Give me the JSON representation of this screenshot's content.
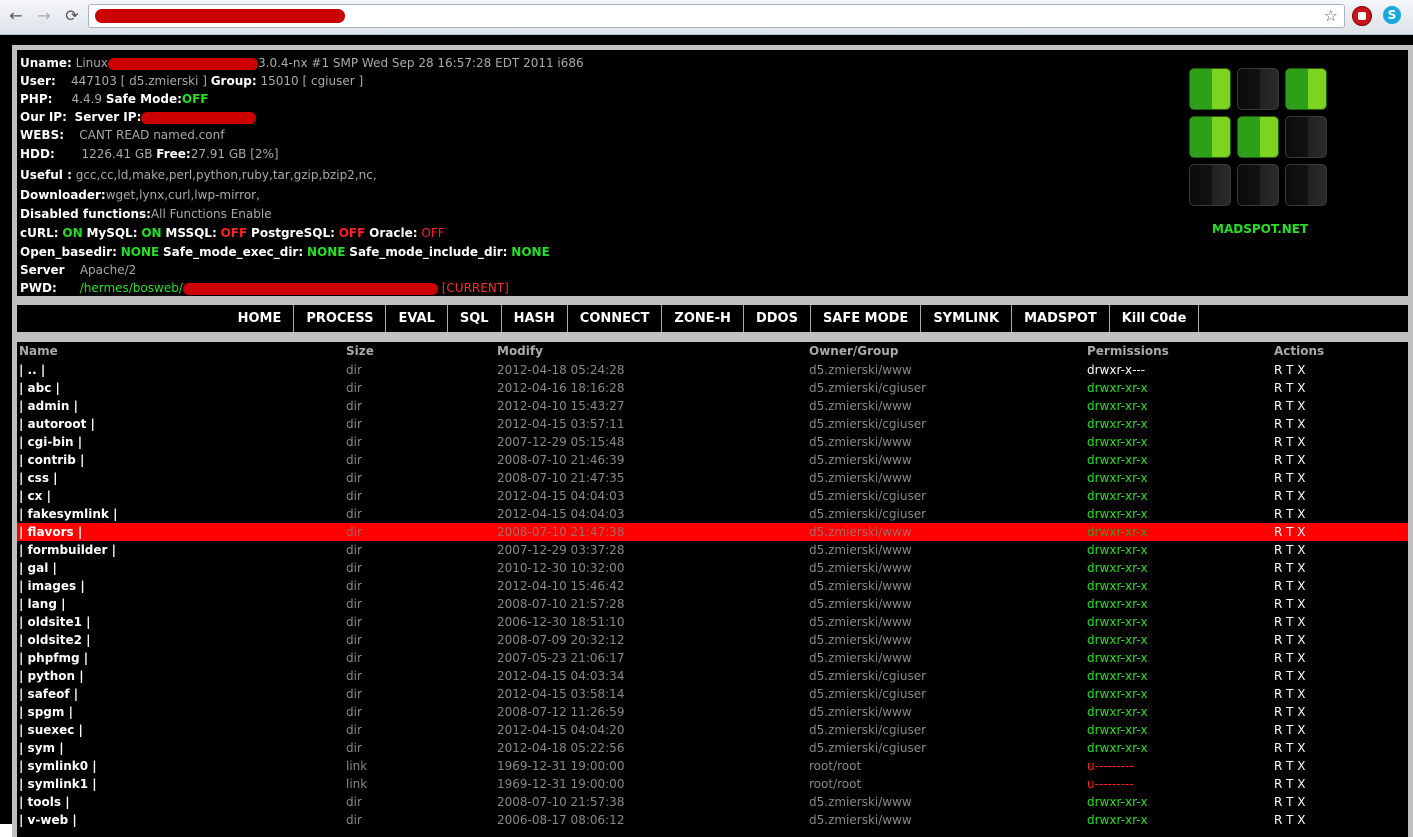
{
  "browser": {
    "back": "←",
    "forward": "→",
    "reload": "⟳",
    "star": "☆",
    "skype": "S"
  },
  "info": {
    "uname_label": "Uname:",
    "uname_prefix": "Linux",
    "uname_value": "3.0.4-nx #1 SMP Wed Sep 28 16:57:28 EDT 2011 i686",
    "user_label": "User:",
    "user_value": "447103 [ d5.zmierski ]",
    "group_label": "Group:",
    "group_value": "15010 [ cgiuser ]",
    "php_label": "PHP:",
    "php_value": "4.4.9",
    "safemode_label": "Safe Mode:",
    "safemode_value": "OFF",
    "ourip_label": "Our IP:",
    "serverip_label": "Server IP:",
    "webs_label": "WEBS:",
    "webs_value": "CANT READ named.conf",
    "hdd_label": "HDD:",
    "hdd_value": "1226.41 GB",
    "free_label": "Free:",
    "free_value": "27.91 GB [2%]",
    "useful_label": "Useful :",
    "useful_value": "gcc,cc,ld,make,perl,python,ruby,tar,gzip,bzip2,nc,",
    "downloader_label": "Downloader:",
    "downloader_value": "wget,lynx,curl,lwp-mirror,",
    "disabled_label": "Disabled functions:",
    "disabled_value": "All Functions Enable",
    "curl_label": "cURL:",
    "curl_value": "ON",
    "mysql_label": "MySQL:",
    "mysql_value": "ON",
    "mssql_label": "MSSQL:",
    "mssql_value": "OFF",
    "pgsql_label": "PostgreSQL:",
    "pgsql_value": "OFF",
    "oracle_label": "Oracle:",
    "oracle_value": "OFF",
    "openbasedir_label": "Open_basedir:",
    "openbasedir_value": "NONE",
    "exec_label": "Safe_mode_exec_dir:",
    "exec_value": "NONE",
    "include_label": "Safe_mode_include_dir:",
    "include_value": "NONE",
    "server_label": "Server",
    "server_value": "Apache/2",
    "pwd_label": "PWD:",
    "pwd_value": "/hermes/bosweb/",
    "pwd_current": "[CURRENT]"
  },
  "logo": {
    "caption": "MADSPOT.NET"
  },
  "nav": [
    "HOME",
    "PROCESS",
    "EVAL",
    "SQL",
    "HASH",
    "CONNECT",
    "ZONE-H",
    "DDOS",
    "SAFE MODE",
    "SYMLINK",
    "MADSPOT",
    "Kill C0de"
  ],
  "table": {
    "headers": {
      "name": "Name",
      "size": "Size",
      "modify": "Modify",
      "owner": "Owner/Group",
      "permissions": "Permissions",
      "actions": "Actions"
    },
    "rows": [
      {
        "name": "| .. |",
        "size": "dir",
        "modify": "2012-04-18 05:24:28",
        "owner": "d5.zmierski/www",
        "perm": "drwxr-x---",
        "actions": "R T X"
      },
      {
        "name": "| abc |",
        "size": "dir",
        "modify": "2012-04-16 18:16:28",
        "owner": "d5.zmierski/cgiuser",
        "perm": "drwxr-xr-x",
        "actions": "R T X"
      },
      {
        "name": "| admin |",
        "size": "dir",
        "modify": "2012-04-10 15:43:27",
        "owner": "d5.zmierski/www",
        "perm": "drwxr-xr-x",
        "actions": "R T X"
      },
      {
        "name": "| autoroot |",
        "size": "dir",
        "modify": "2012-04-15 03:57:11",
        "owner": "d5.zmierski/cgiuser",
        "perm": "drwxr-xr-x",
        "actions": "R T X"
      },
      {
        "name": "| cgi-bin |",
        "size": "dir",
        "modify": "2007-12-29 05:15:48",
        "owner": "d5.zmierski/www",
        "perm": "drwxr-xr-x",
        "actions": "R T X"
      },
      {
        "name": "| contrib |",
        "size": "dir",
        "modify": "2008-07-10 21:46:39",
        "owner": "d5.zmierski/www",
        "perm": "drwxr-xr-x",
        "actions": "R T X"
      },
      {
        "name": "| css |",
        "size": "dir",
        "modify": "2008-07-10 21:47:35",
        "owner": "d5.zmierski/www",
        "perm": "drwxr-xr-x",
        "actions": "R T X"
      },
      {
        "name": "| cx |",
        "size": "dir",
        "modify": "2012-04-15 04:04:03",
        "owner": "d5.zmierski/cgiuser",
        "perm": "drwxr-xr-x",
        "actions": "R T X"
      },
      {
        "name": "| fakesymlink |",
        "size": "dir",
        "modify": "2012-04-15 04:04:03",
        "owner": "d5.zmierski/cgiuser",
        "perm": "drwxr-xr-x",
        "actions": "R T X"
      },
      {
        "name": "| flavors |",
        "size": "dir",
        "modify": "2008-07-10 21:47:38",
        "owner": "d5.zmierski/www",
        "perm": "drwxr-xr-x",
        "actions": "R T X"
      },
      {
        "name": "| formbuilder |",
        "size": "dir",
        "modify": "2007-12-29 03:37:28",
        "owner": "d5.zmierski/www",
        "perm": "drwxr-xr-x",
        "actions": "R T X"
      },
      {
        "name": "| gal |",
        "size": "dir",
        "modify": "2010-12-30 10:32:00",
        "owner": "d5.zmierski/www",
        "perm": "drwxr-xr-x",
        "actions": "R T X"
      },
      {
        "name": "| images |",
        "size": "dir",
        "modify": "2012-04-10 15:46:42",
        "owner": "d5.zmierski/www",
        "perm": "drwxr-xr-x",
        "actions": "R T X"
      },
      {
        "name": "| lang |",
        "size": "dir",
        "modify": "2008-07-10 21:57:28",
        "owner": "d5.zmierski/www",
        "perm": "drwxr-xr-x",
        "actions": "R T X"
      },
      {
        "name": "| oldsite1 |",
        "size": "dir",
        "modify": "2006-12-30 18:51:10",
        "owner": "d5.zmierski/www",
        "perm": "drwxr-xr-x",
        "actions": "R T X"
      },
      {
        "name": "| oldsite2 |",
        "size": "dir",
        "modify": "2008-07-09 20:32:12",
        "owner": "d5.zmierski/www",
        "perm": "drwxr-xr-x",
        "actions": "R T X"
      },
      {
        "name": "| phpfmg |",
        "size": "dir",
        "modify": "2007-05-23 21:06:17",
        "owner": "d5.zmierski/www",
        "perm": "drwxr-xr-x",
        "actions": "R T X"
      },
      {
        "name": "| python |",
        "size": "dir",
        "modify": "2012-04-15 04:03:34",
        "owner": "d5.zmierski/cgiuser",
        "perm": "drwxr-xr-x",
        "actions": "R T X"
      },
      {
        "name": "| safeof |",
        "size": "dir",
        "modify": "2012-04-15 03:58:14",
        "owner": "d5.zmierski/cgiuser",
        "perm": "drwxr-xr-x",
        "actions": "R T X"
      },
      {
        "name": "| spgm |",
        "size": "dir",
        "modify": "2008-07-12 11:26:59",
        "owner": "d5.zmierski/www",
        "perm": "drwxr-xr-x",
        "actions": "R T X"
      },
      {
        "name": "| suexec |",
        "size": "dir",
        "modify": "2012-04-15 04:04:20",
        "owner": "d5.zmierski/cgiuser",
        "perm": "drwxr-xr-x",
        "actions": "R T X"
      },
      {
        "name": "| sym |",
        "size": "dir",
        "modify": "2012-04-18 05:22:56",
        "owner": "d5.zmierski/cgiuser",
        "perm": "drwxr-xr-x",
        "actions": "R T X"
      },
      {
        "name": "| symlink0 |",
        "size": "link",
        "modify": "1969-12-31 19:00:00",
        "owner": "root/root",
        "perm": "u---------",
        "actions": "R T X"
      },
      {
        "name": "| symlink1 |",
        "size": "link",
        "modify": "1969-12-31 19:00:00",
        "owner": "root/root",
        "perm": "u---------",
        "actions": "R T X"
      },
      {
        "name": "| tools |",
        "size": "dir",
        "modify": "2008-07-10 21:57:38",
        "owner": "d5.zmierski/www",
        "perm": "drwxr-xr-x",
        "actions": "R T X"
      },
      {
        "name": "| v-web |",
        "size": "dir",
        "modify": "2006-08-17 08:06:12",
        "owner": "d5.zmierski/www",
        "perm": "drwxr-xr-x",
        "actions": "R T X"
      }
    ],
    "selected_index": 9,
    "perm_colors": {
      "drwxr-x---": "#ffffff",
      "drwxr-xr-x": "#23e023",
      "u---------": "#ff2020"
    }
  }
}
